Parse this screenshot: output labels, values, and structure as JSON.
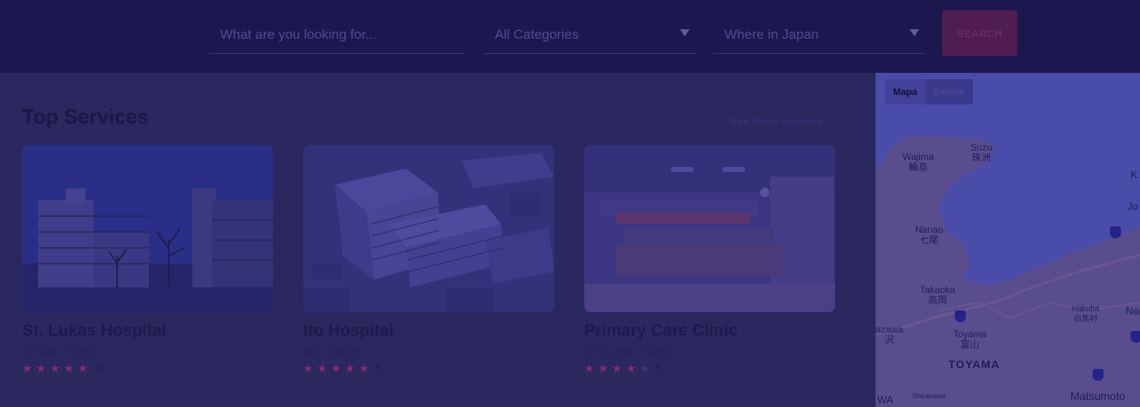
{
  "search": {
    "query_placeholder": "What are you looking for...",
    "category_value": "All Categories",
    "location_value": "Where in Japan",
    "button_label": "SEARCH"
  },
  "section": {
    "title": "Top Services",
    "see_more": "See more services..."
  },
  "cards": [
    {
      "name": "St. Lukas Hospital",
      "location": "Ginza, Tokyo",
      "rating": 5,
      "reviews": "10"
    },
    {
      "name": "Ito Hospital",
      "location": "Ito, Tokyo",
      "rating": 5,
      "reviews": "8"
    },
    {
      "name": "Primary Care Clinic",
      "location": "Shibuya, Tokyo",
      "rating": 4,
      "reviews": "5"
    }
  ],
  "map": {
    "tab_map": "Mapa",
    "tab_satellite": "Satelite",
    "labels": {
      "wajima": "Wajima\n輪島",
      "suzu": "Suzu\n珠洲",
      "nanao": "Nanao\n七尾",
      "takaoka": "Takaoka\n高岡",
      "toyama": "Toyama\n富山",
      "toyama_pref": "TOYAMA",
      "hakuba": "Hakuba\n白馬村",
      "kanazawa": "azawa\n沢",
      "matsumoto": "Matsumoto",
      "shirakawa": "Shirakawa",
      "nag": "Nag",
      "jo": "Jo",
      "k": "K",
      "wa": "WA"
    }
  },
  "colors": {
    "overlay": "#2a285e",
    "header": "#1b1850",
    "accent_button": "#4f1d4f",
    "star_on": "#8a2a74",
    "star_off": "#3a3780"
  }
}
